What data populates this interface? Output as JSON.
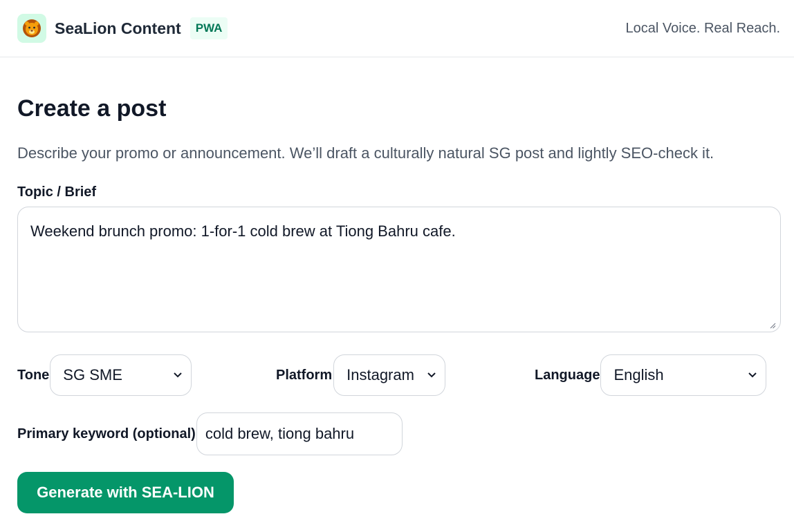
{
  "header": {
    "app_title": "SeaLion Content",
    "badge": "PWA",
    "tagline": "Local Voice. Real Reach.",
    "logo_icon": "lion-emoji-icon"
  },
  "form": {
    "title": "Create a post",
    "description": "Describe your promo or announcement. We’ll draft a culturally natural SG post and lightly SEO-check it.",
    "topic_label": "Topic / Brief",
    "topic_value": "Weekend brunch promo: 1-for-1 cold brew at Tiong Bahru cafe.",
    "tone_label": "Tone",
    "tone_value": "SG SME",
    "platform_label": "Platform",
    "platform_value": "Instagram",
    "language_label": "Language",
    "language_value": "English",
    "keyword_label": "Primary keyword (optional)",
    "keyword_value": "cold brew, tiong bahru",
    "generate_label": "Generate with SEA-LION"
  },
  "colors": {
    "accent": "#059669",
    "badge_bg": "#ecfdf5",
    "badge_text": "#047857",
    "logo_bg": "#d1fae5"
  }
}
